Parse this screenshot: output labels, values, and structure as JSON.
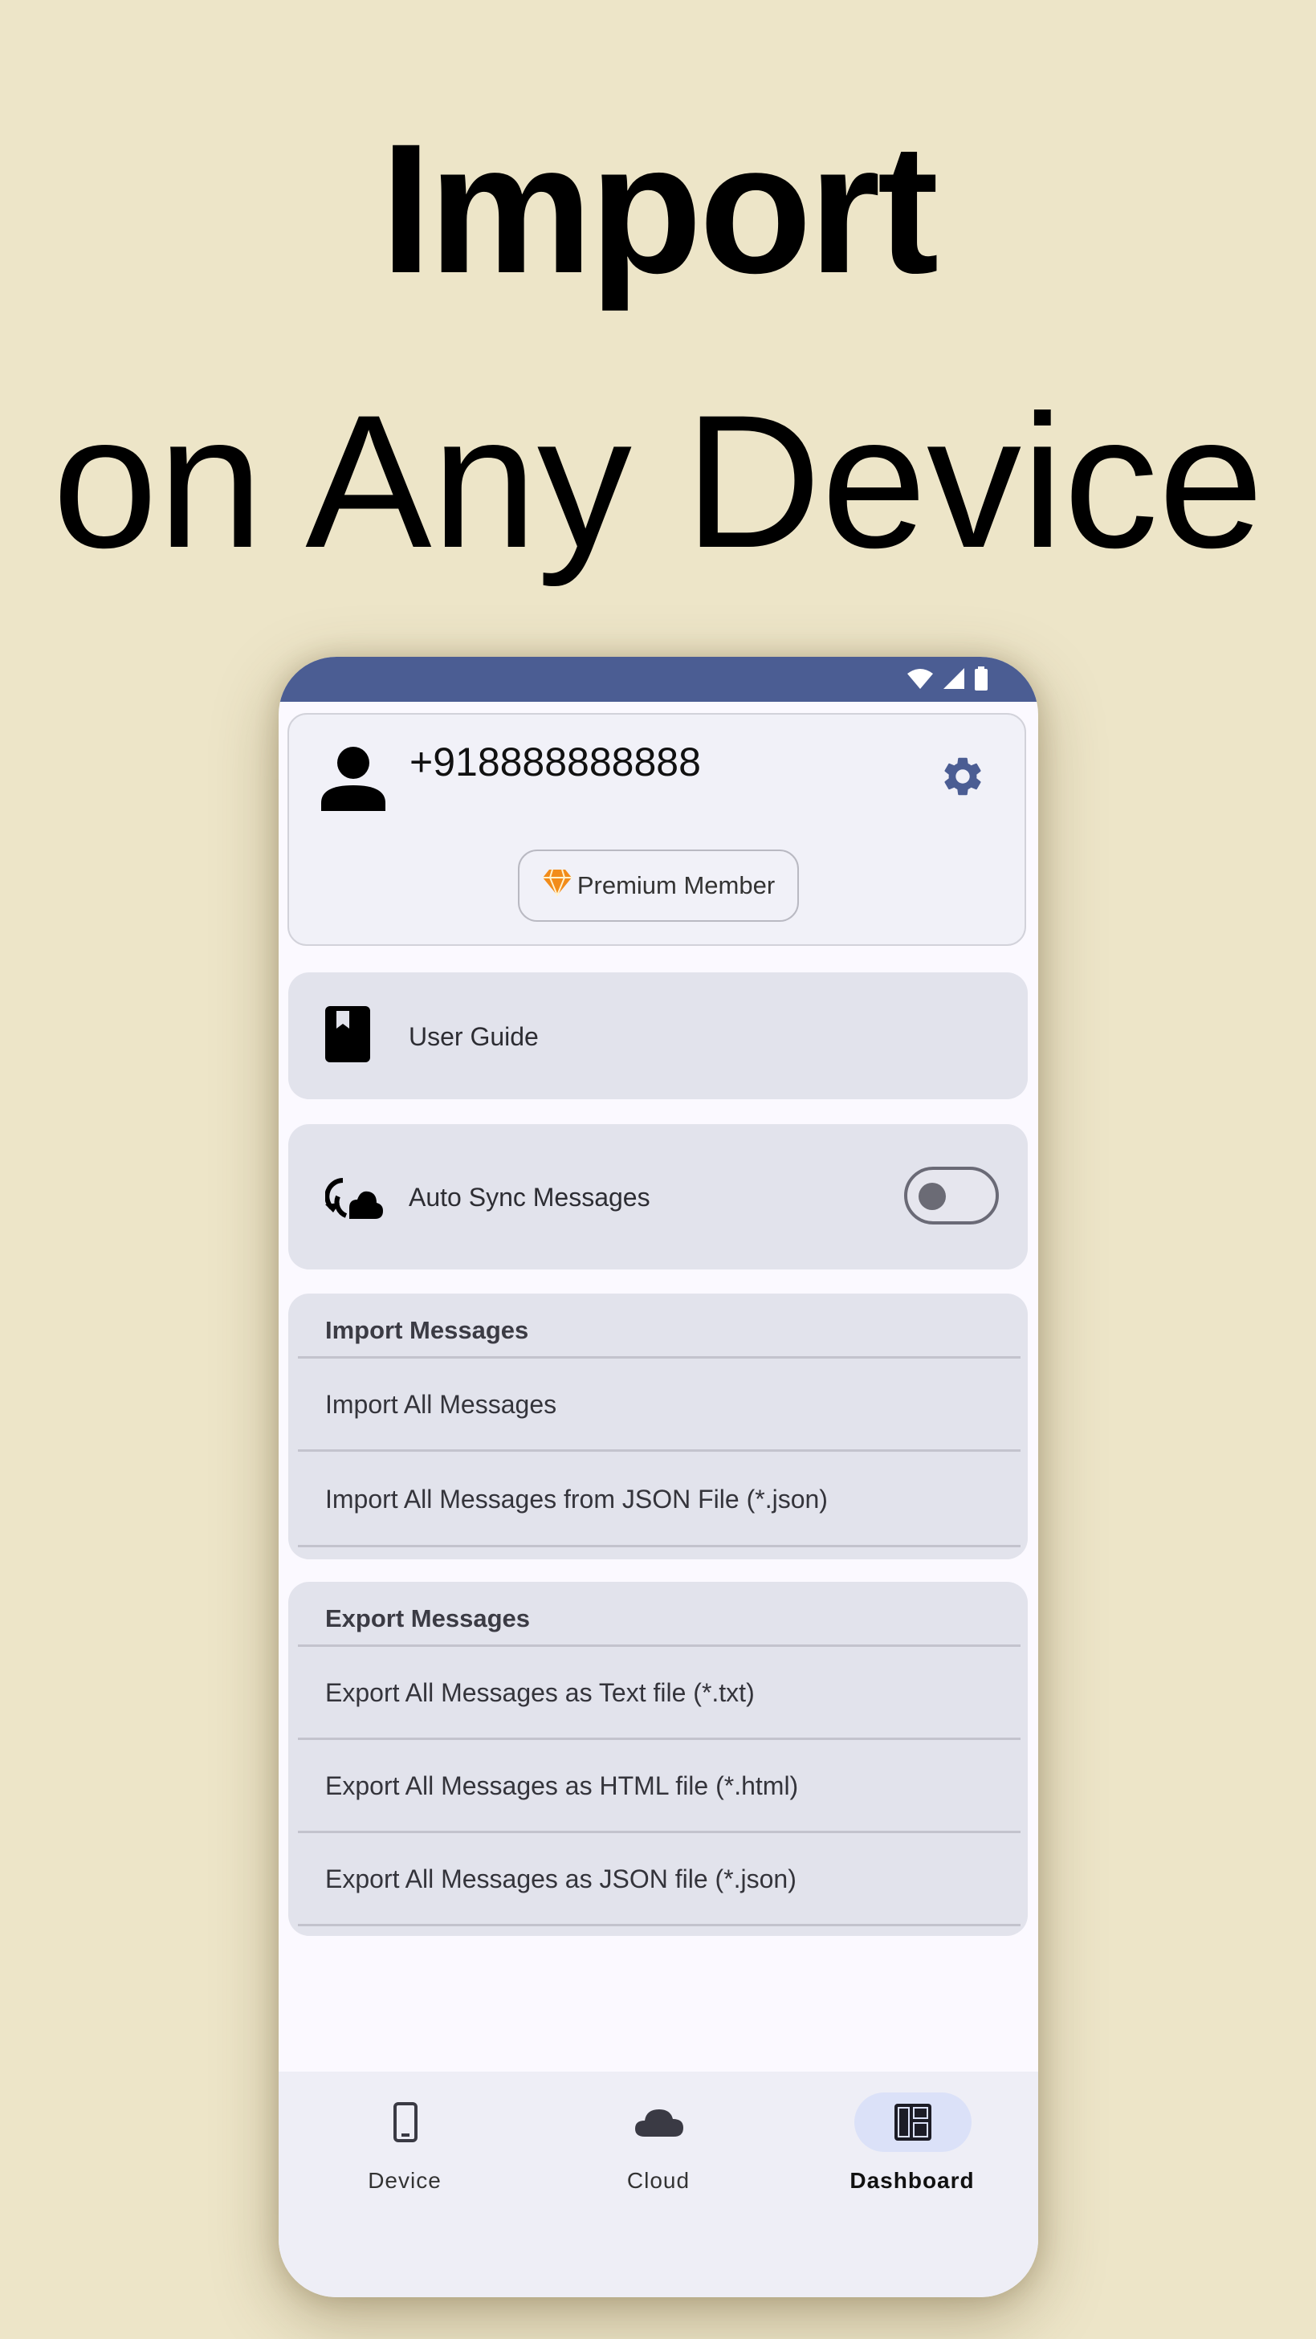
{
  "headline": {
    "line1": "Import",
    "line2": "on Any Device"
  },
  "status_bar": {
    "icons": [
      "wifi-icon",
      "cell-signal-icon",
      "battery-icon"
    ]
  },
  "profile": {
    "phone_number": "+918888888888",
    "badge_label": "Premium Member",
    "icons": [
      "person-icon",
      "gear-icon",
      "diamond-icon"
    ]
  },
  "user_guide": {
    "label": "User Guide",
    "icon": "book-icon"
  },
  "auto_sync": {
    "label": "Auto Sync Messages",
    "icon": "cloud-sync-icon",
    "enabled": false
  },
  "import_section": {
    "title": "Import Messages",
    "items": [
      "Import All Messages",
      "Import All Messages from JSON File (*.json)"
    ]
  },
  "export_section": {
    "title": "Export Messages",
    "items": [
      "Export All Messages as Text file (*.txt)",
      "Export All Messages as HTML file (*.html)",
      "Export All Messages as JSON file (*.json)"
    ]
  },
  "bottom_nav": {
    "items": [
      {
        "label": "Device",
        "icon": "phone-icon",
        "active": false
      },
      {
        "label": "Cloud",
        "icon": "cloud-icon",
        "active": false
      },
      {
        "label": "Dashboard",
        "icon": "dashboard-icon",
        "active": true
      }
    ]
  },
  "colors": {
    "background": "#ede5c8",
    "status_bar": "#4b5d93",
    "accent": "#4b5d93",
    "card": "#e2e3ec",
    "diamond": "#f28c1a"
  }
}
